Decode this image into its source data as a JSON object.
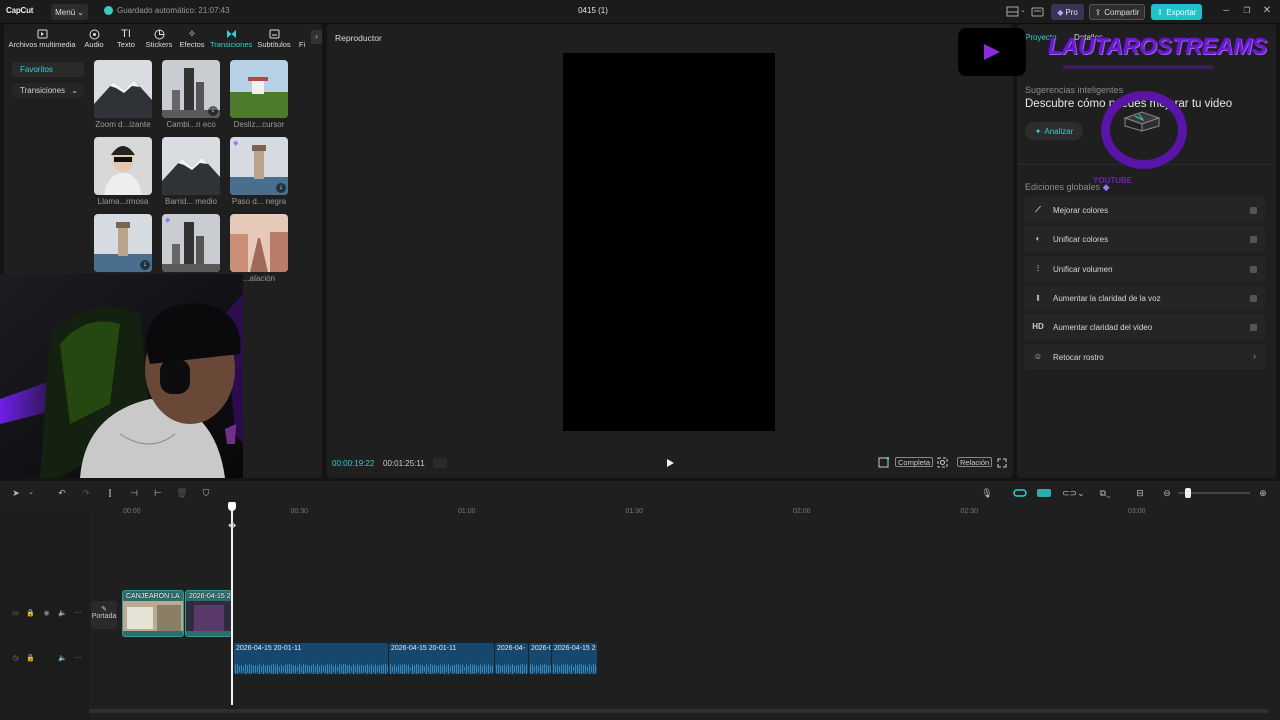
{
  "app": {
    "logo": "CapCut",
    "menu_label": "Menú",
    "autosave": "Guardado automático: 21:07:43",
    "project_name": "0415 (1)",
    "pro_label": "Pro",
    "share_label": "Compartir",
    "export_label": "Exportar"
  },
  "accent": "#2fd1d1",
  "media_tabs": [
    "Archivos multimedia",
    "Audio",
    "Texto",
    "Stickers",
    "Efectos",
    "Transiciones",
    "Subtítulos",
    "Fi"
  ],
  "media_sidebar": {
    "favorites": "Favoritos",
    "transitions": "Transiciones"
  },
  "transitions": [
    {
      "label": "Zoom d...izante",
      "icon": "mountain-thumbnail"
    },
    {
      "label": "Cambi...n eco",
      "icon": "tower-thumbnail"
    },
    {
      "label": "Desliz...cursor",
      "icon": "field-thumbnail"
    },
    {
      "label": "Llama...rmosa",
      "icon": "portrait-thumbnail"
    },
    {
      "label": "Barrid... medio",
      "icon": "mountain-thumbnail"
    },
    {
      "label": "Paso d... negra",
      "icon": "lighthouse-thumbnail"
    },
    {
      "label": "",
      "icon": "lighthouse-thumbnail"
    },
    {
      "label": "",
      "icon": "tower-thumbnail"
    },
    {
      "label": "...alación",
      "icon": "street-thumbnail"
    }
  ],
  "player": {
    "title": "Reproductor",
    "current_time": "00:00:19:22",
    "total_time": "00:01:25:11",
    "complete_label": "Completa",
    "ratio_label": "Relación"
  },
  "right_panel": {
    "tab_project": "Proyecto",
    "tab_details": "Detalles",
    "suggestions_heading": "Sugerencias inteligentes",
    "suggestions_text": "Descubre cómo puedes mejorar tu video",
    "analyze_label": "Analizar",
    "global_edits_heading": "Ediciones globales",
    "items": [
      {
        "label": "Mejorar colores",
        "icon": "wand-icon"
      },
      {
        "label": "Unificar colores",
        "icon": "palette-icon"
      },
      {
        "label": "Unificar volumen",
        "icon": "sliders-icon"
      },
      {
        "label": "Aumentar la claridad de la voz",
        "icon": "voice-icon"
      },
      {
        "label": "Aumentar claridad del video",
        "icon": "hd-icon"
      },
      {
        "label": "Retocar rostro",
        "icon": "face-icon"
      }
    ]
  },
  "overlay": {
    "brand": "LAUTAROSTREAMS",
    "ring_text": "YOUTUBE"
  },
  "timeline": {
    "ruler": [
      "00:00",
      "00:30",
      "01:00",
      "01:30",
      "02:00",
      "02:30",
      "03:00"
    ],
    "cover_label": "Portada",
    "video_clips": [
      "CANJEARON LA",
      "2026-04-15 2"
    ],
    "audio_clips": [
      "2026-04-15 20-01-11",
      "2026-04-15 20-01-11",
      "2026-04-",
      "2026-0",
      "2026-04-15 2"
    ]
  }
}
